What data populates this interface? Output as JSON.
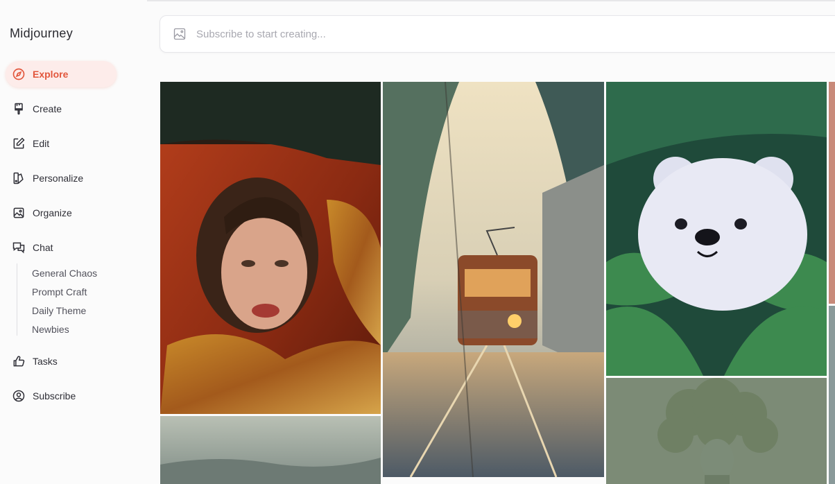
{
  "app": {
    "title": "Midjourney"
  },
  "nav": {
    "items": [
      {
        "label": "Explore",
        "icon": "compass-icon",
        "active": true
      },
      {
        "label": "Create",
        "icon": "paintbrush-icon"
      },
      {
        "label": "Edit",
        "icon": "pencil-square-icon"
      },
      {
        "label": "Personalize",
        "icon": "palette-icon"
      },
      {
        "label": "Organize",
        "icon": "image-icon"
      },
      {
        "label": "Chat",
        "icon": "chat-bubbles-icon"
      },
      {
        "label": "Tasks",
        "icon": "thumbs-up-icon"
      },
      {
        "label": "Subscribe",
        "icon": "user-circle-icon"
      }
    ],
    "chat_rooms": [
      "General Chaos",
      "Prompt Craft",
      "Daily Theme",
      "Newbies"
    ]
  },
  "search": {
    "placeholder": "Subscribe to start creating..."
  },
  "gallery": {
    "images": [
      {
        "subject": "woman-portrait"
      },
      {
        "subject": "tram-street-painting"
      },
      {
        "subject": "white-bear-in-ferns"
      },
      {
        "subject": "broccoli-head-statue"
      },
      {
        "subject": "hazy-landscape"
      }
    ]
  },
  "colors": {
    "accent": "#e2563c",
    "active_bg": "#fdecea",
    "background": "#fbfbfb"
  }
}
